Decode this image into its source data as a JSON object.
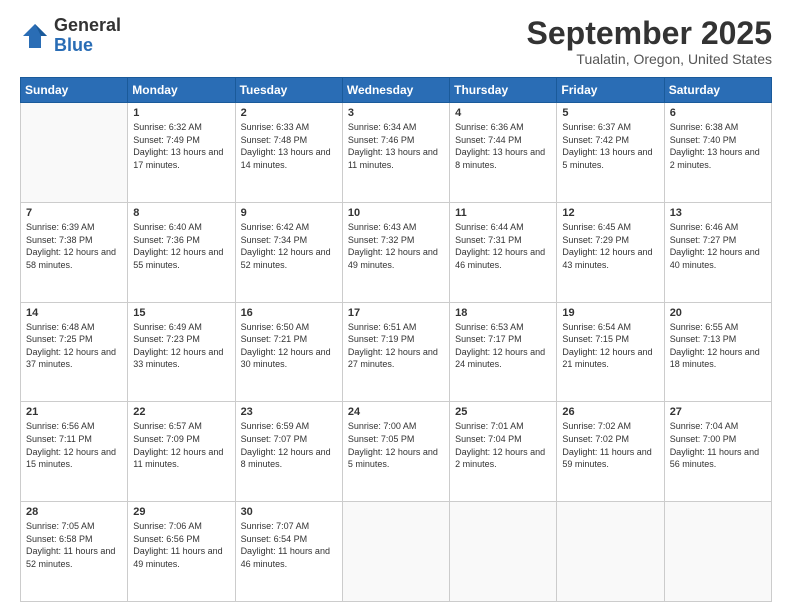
{
  "logo": {
    "general": "General",
    "blue": "Blue"
  },
  "title": "September 2025",
  "location": "Tualatin, Oregon, United States",
  "days_header": [
    "Sunday",
    "Monday",
    "Tuesday",
    "Wednesday",
    "Thursday",
    "Friday",
    "Saturday"
  ],
  "weeks": [
    [
      {
        "num": "",
        "empty": true
      },
      {
        "num": "1",
        "sunrise": "Sunrise: 6:32 AM",
        "sunset": "Sunset: 7:49 PM",
        "daylight": "Daylight: 13 hours and 17 minutes."
      },
      {
        "num": "2",
        "sunrise": "Sunrise: 6:33 AM",
        "sunset": "Sunset: 7:48 PM",
        "daylight": "Daylight: 13 hours and 14 minutes."
      },
      {
        "num": "3",
        "sunrise": "Sunrise: 6:34 AM",
        "sunset": "Sunset: 7:46 PM",
        "daylight": "Daylight: 13 hours and 11 minutes."
      },
      {
        "num": "4",
        "sunrise": "Sunrise: 6:36 AM",
        "sunset": "Sunset: 7:44 PM",
        "daylight": "Daylight: 13 hours and 8 minutes."
      },
      {
        "num": "5",
        "sunrise": "Sunrise: 6:37 AM",
        "sunset": "Sunset: 7:42 PM",
        "daylight": "Daylight: 13 hours and 5 minutes."
      },
      {
        "num": "6",
        "sunrise": "Sunrise: 6:38 AM",
        "sunset": "Sunset: 7:40 PM",
        "daylight": "Daylight: 13 hours and 2 minutes."
      }
    ],
    [
      {
        "num": "7",
        "sunrise": "Sunrise: 6:39 AM",
        "sunset": "Sunset: 7:38 PM",
        "daylight": "Daylight: 12 hours and 58 minutes."
      },
      {
        "num": "8",
        "sunrise": "Sunrise: 6:40 AM",
        "sunset": "Sunset: 7:36 PM",
        "daylight": "Daylight: 12 hours and 55 minutes."
      },
      {
        "num": "9",
        "sunrise": "Sunrise: 6:42 AM",
        "sunset": "Sunset: 7:34 PM",
        "daylight": "Daylight: 12 hours and 52 minutes."
      },
      {
        "num": "10",
        "sunrise": "Sunrise: 6:43 AM",
        "sunset": "Sunset: 7:32 PM",
        "daylight": "Daylight: 12 hours and 49 minutes."
      },
      {
        "num": "11",
        "sunrise": "Sunrise: 6:44 AM",
        "sunset": "Sunset: 7:31 PM",
        "daylight": "Daylight: 12 hours and 46 minutes."
      },
      {
        "num": "12",
        "sunrise": "Sunrise: 6:45 AM",
        "sunset": "Sunset: 7:29 PM",
        "daylight": "Daylight: 12 hours and 43 minutes."
      },
      {
        "num": "13",
        "sunrise": "Sunrise: 6:46 AM",
        "sunset": "Sunset: 7:27 PM",
        "daylight": "Daylight: 12 hours and 40 minutes."
      }
    ],
    [
      {
        "num": "14",
        "sunrise": "Sunrise: 6:48 AM",
        "sunset": "Sunset: 7:25 PM",
        "daylight": "Daylight: 12 hours and 37 minutes."
      },
      {
        "num": "15",
        "sunrise": "Sunrise: 6:49 AM",
        "sunset": "Sunset: 7:23 PM",
        "daylight": "Daylight: 12 hours and 33 minutes."
      },
      {
        "num": "16",
        "sunrise": "Sunrise: 6:50 AM",
        "sunset": "Sunset: 7:21 PM",
        "daylight": "Daylight: 12 hours and 30 minutes."
      },
      {
        "num": "17",
        "sunrise": "Sunrise: 6:51 AM",
        "sunset": "Sunset: 7:19 PM",
        "daylight": "Daylight: 12 hours and 27 minutes."
      },
      {
        "num": "18",
        "sunrise": "Sunrise: 6:53 AM",
        "sunset": "Sunset: 7:17 PM",
        "daylight": "Daylight: 12 hours and 24 minutes."
      },
      {
        "num": "19",
        "sunrise": "Sunrise: 6:54 AM",
        "sunset": "Sunset: 7:15 PM",
        "daylight": "Daylight: 12 hours and 21 minutes."
      },
      {
        "num": "20",
        "sunrise": "Sunrise: 6:55 AM",
        "sunset": "Sunset: 7:13 PM",
        "daylight": "Daylight: 12 hours and 18 minutes."
      }
    ],
    [
      {
        "num": "21",
        "sunrise": "Sunrise: 6:56 AM",
        "sunset": "Sunset: 7:11 PM",
        "daylight": "Daylight: 12 hours and 15 minutes."
      },
      {
        "num": "22",
        "sunrise": "Sunrise: 6:57 AM",
        "sunset": "Sunset: 7:09 PM",
        "daylight": "Daylight: 12 hours and 11 minutes."
      },
      {
        "num": "23",
        "sunrise": "Sunrise: 6:59 AM",
        "sunset": "Sunset: 7:07 PM",
        "daylight": "Daylight: 12 hours and 8 minutes."
      },
      {
        "num": "24",
        "sunrise": "Sunrise: 7:00 AM",
        "sunset": "Sunset: 7:05 PM",
        "daylight": "Daylight: 12 hours and 5 minutes."
      },
      {
        "num": "25",
        "sunrise": "Sunrise: 7:01 AM",
        "sunset": "Sunset: 7:04 PM",
        "daylight": "Daylight: 12 hours and 2 minutes."
      },
      {
        "num": "26",
        "sunrise": "Sunrise: 7:02 AM",
        "sunset": "Sunset: 7:02 PM",
        "daylight": "Daylight: 11 hours and 59 minutes."
      },
      {
        "num": "27",
        "sunrise": "Sunrise: 7:04 AM",
        "sunset": "Sunset: 7:00 PM",
        "daylight": "Daylight: 11 hours and 56 minutes."
      }
    ],
    [
      {
        "num": "28",
        "sunrise": "Sunrise: 7:05 AM",
        "sunset": "Sunset: 6:58 PM",
        "daylight": "Daylight: 11 hours and 52 minutes."
      },
      {
        "num": "29",
        "sunrise": "Sunrise: 7:06 AM",
        "sunset": "Sunset: 6:56 PM",
        "daylight": "Daylight: 11 hours and 49 minutes."
      },
      {
        "num": "30",
        "sunrise": "Sunrise: 7:07 AM",
        "sunset": "Sunset: 6:54 PM",
        "daylight": "Daylight: 11 hours and 46 minutes."
      },
      {
        "num": "",
        "empty": true
      },
      {
        "num": "",
        "empty": true
      },
      {
        "num": "",
        "empty": true
      },
      {
        "num": "",
        "empty": true
      }
    ]
  ]
}
